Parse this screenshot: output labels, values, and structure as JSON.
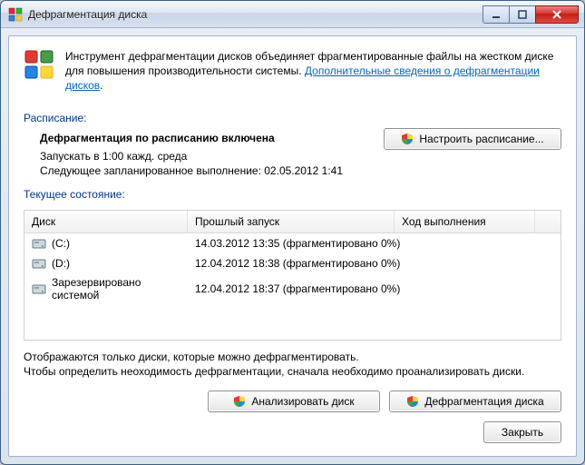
{
  "window": {
    "title": "Дефрагментация диска"
  },
  "intro": {
    "text_before_link": "Инструмент дефрагментации дисков объединяет фрагментированные файлы на жестком диске для повышения производительности системы. ",
    "link_text": "Дополнительные сведения о дефрагментации дисков",
    "link_suffix": "."
  },
  "schedule": {
    "section_label": "Расписание:",
    "status": "Дефрагментация по расписанию включена",
    "run_at": "Запускать в 1:00 кажд. среда",
    "next_run": "Следующее запланированное выполнение: 02.05.2012 1:41",
    "configure_btn": "Настроить расписание..."
  },
  "current": {
    "section_label": "Текущее состояние:",
    "columns": {
      "disk": "Диск",
      "last": "Прошлый запуск",
      "progress": "Ход выполнения"
    },
    "rows": [
      {
        "icon": "hdd",
        "name": "(C:)",
        "last": "14.03.2012 13:35 (фрагментировано 0%)"
      },
      {
        "icon": "hdd",
        "name": "(D:)",
        "last": "12.04.2012 18:38 (фрагментировано 0%)"
      },
      {
        "icon": "hdd",
        "name": "Зарезервировано системой",
        "last": "12.04.2012 18:37 (фрагментировано 0%)"
      }
    ]
  },
  "hint": {
    "line1": "Отображаются только диски, которые можно дефрагментировать.",
    "line2": "Чтобы определить неоходимость  дефрагментации, сначала необходимо проанализировать диски."
  },
  "buttons": {
    "analyze": "Анализировать диск",
    "defrag": "Дефрагментация диска",
    "close": "Закрыть"
  }
}
